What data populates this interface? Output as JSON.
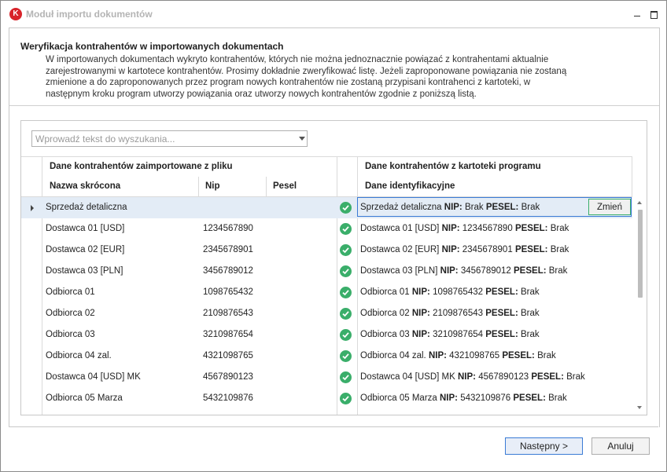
{
  "window": {
    "title": "Moduł importu dokumentów",
    "logo_letter": "K"
  },
  "section": {
    "heading": "Weryfikacja kontrahentów w importowanych dokumentach",
    "desc_lines": [
      "W importowanych dokumentach wykryto kontrahentów, których nie można jednoznacznie powiązać z kontrahentami aktualnie",
      "zarejestrowanymi w kartotece kontrahentów. Prosimy dokładnie zweryfikować listę. Jeżeli zaproponowane powiązania nie zostaną",
      "zmienione a do zaproponowanych przez program nowych kontrahentów nie zostaną przypisani kontrahenci z kartoteki, w",
      "następnym kroku program utworzy powiązania oraz utworzy nowych kontrahentów zgodnie z poniższą listą."
    ]
  },
  "search": {
    "placeholder": "Wprowadź tekst do wyszukania..."
  },
  "grid": {
    "group_left": "Dane kontrahentów zaimportowane z pliku",
    "group_right": "Dane kontrahentów z kartoteki programu",
    "col_name": "Nazwa skrócona",
    "col_nip": "Nip",
    "col_pesel": "Pesel",
    "col_ident": "Dane identyfikacyjne",
    "nip_label": "NIP:",
    "pesel_label": "PESEL:",
    "change_label": "Zmień",
    "rows": [
      {
        "name": "Sprzedaż detaliczna",
        "nip": "",
        "pesel": "",
        "k_name": "Sprzedaż detaliczna",
        "k_nip": "Brak",
        "k_pesel": "Brak",
        "selected": true
      },
      {
        "name": "Dostawca 01 [USD]",
        "nip": "1234567890",
        "pesel": "",
        "k_name": "Dostawca 01 [USD]",
        "k_nip": "1234567890",
        "k_pesel": "Brak"
      },
      {
        "name": "Dostawca 02 [EUR]",
        "nip": "2345678901",
        "pesel": "",
        "k_name": "Dostawca 02 [EUR]",
        "k_nip": "2345678901",
        "k_pesel": "Brak"
      },
      {
        "name": "Dostawca 03 [PLN]",
        "nip": "3456789012",
        "pesel": "",
        "k_name": "Dostawca 03 [PLN]",
        "k_nip": "3456789012",
        "k_pesel": "Brak"
      },
      {
        "name": "Odbiorca 01",
        "nip": "1098765432",
        "pesel": "",
        "k_name": "Odbiorca 01",
        "k_nip": "1098765432",
        "k_pesel": "Brak"
      },
      {
        "name": "Odbiorca 02",
        "nip": "2109876543",
        "pesel": "",
        "k_name": "Odbiorca 02",
        "k_nip": "2109876543",
        "k_pesel": "Brak"
      },
      {
        "name": "Odbiorca 03",
        "nip": "3210987654",
        "pesel": "",
        "k_name": "Odbiorca 03",
        "k_nip": "3210987654",
        "k_pesel": "Brak"
      },
      {
        "name": "Odbiorca 04 zal.",
        "nip": "4321098765",
        "pesel": "",
        "k_name": "Odbiorca 04 zal.",
        "k_nip": "4321098765",
        "k_pesel": "Brak"
      },
      {
        "name": "Dostawca 04 [USD] MK",
        "nip": "4567890123",
        "pesel": "",
        "k_name": "Dostawca 04 [USD] MK",
        "k_nip": "4567890123",
        "k_pesel": "Brak"
      },
      {
        "name": "Odbiorca 05 Marza",
        "nip": "5432109876",
        "pesel": "",
        "k_name": "Odbiorca 05 Marza",
        "k_nip": "5432109876",
        "k_pesel": "Brak"
      }
    ]
  },
  "buttons": {
    "next": "Następny >",
    "cancel": "Anuluj"
  },
  "colors": {
    "accent": "#3a7bd5",
    "check": "#3aae6a",
    "logo": "#d8232a",
    "selected_row": "#e3ecf6"
  }
}
